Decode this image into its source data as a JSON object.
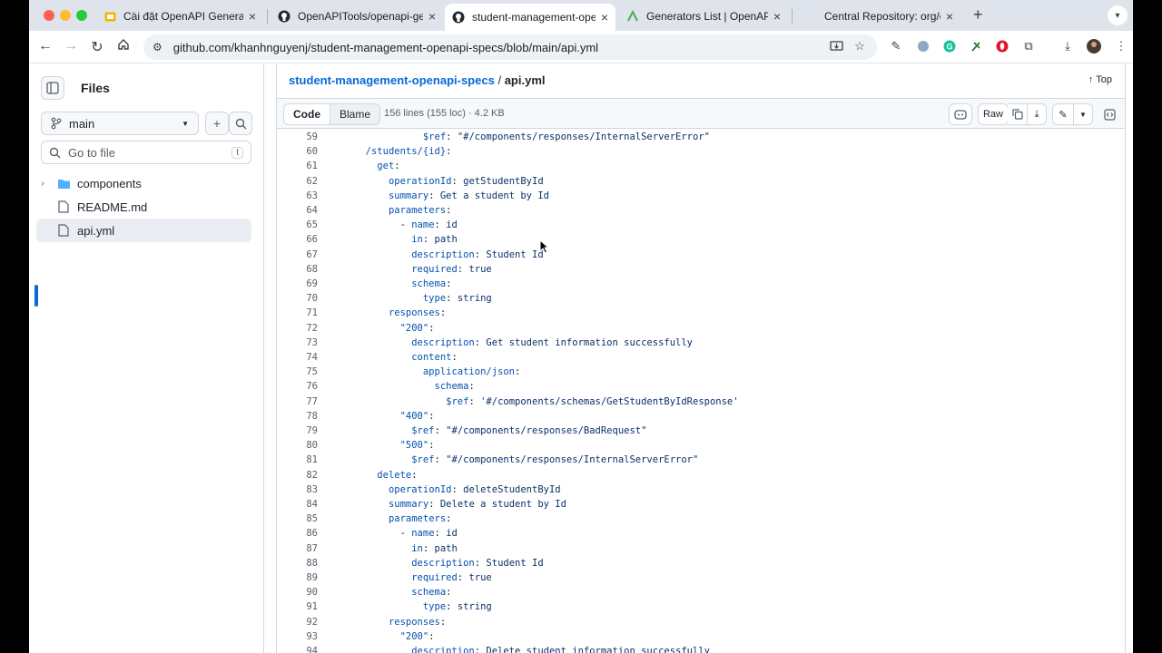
{
  "browser": {
    "tabs": [
      {
        "label": "Cài đặt OpenAPI Generator C",
        "favicon": "slides-icon"
      },
      {
        "label": "OpenAPITools/openapi-gener",
        "favicon": "github-icon"
      },
      {
        "label": "student-management-openap",
        "favicon": "github-icon"
      },
      {
        "label": "Generators List | OpenAPI Ge",
        "favicon": "openapi-icon"
      },
      {
        "label": "Central Repository: org/openc",
        "favicon": "none"
      }
    ],
    "address": "github.com/khanhnguyenj/student-management-openapi-specs/blob/main/api.yml"
  },
  "sidebar": {
    "title": "Files",
    "branch": "main",
    "goto_placeholder": "Go to file",
    "goto_shortcut": "t",
    "tree": [
      {
        "label": "components",
        "type": "folder"
      },
      {
        "label": "README.md",
        "type": "file"
      },
      {
        "label": "api.yml",
        "type": "file",
        "selected": true
      }
    ]
  },
  "breadcrumb": {
    "repo": "student-management-openapi-specs",
    "sep": "/",
    "file": "api.yml"
  },
  "top_link": "Top",
  "file_header": {
    "code_tab": "Code",
    "blame_tab": "Blame",
    "info": "156 lines (155 loc) · 4.2 KB",
    "raw_label": "Raw"
  },
  "code_lines": [
    {
      "n": "59",
      "indent": 6,
      "key": "$ref",
      "val": "\"#/components/responses/InternalServerError\""
    },
    {
      "n": "60",
      "indent": 1,
      "key": "/students/{id}",
      "val": ""
    },
    {
      "n": "61",
      "indent": 2,
      "key": "get",
      "val": ""
    },
    {
      "n": "62",
      "indent": 3,
      "key": "operationId",
      "val": "getStudentById"
    },
    {
      "n": "63",
      "indent": 3,
      "key": "summary",
      "val": "Get a student by Id"
    },
    {
      "n": "64",
      "indent": 3,
      "key": "parameters",
      "val": ""
    },
    {
      "n": "65",
      "indent": 4,
      "key": "name",
      "val": "id",
      "dash": true
    },
    {
      "n": "66",
      "indent": 5,
      "key": "in",
      "val": "path"
    },
    {
      "n": "67",
      "indent": 5,
      "key": "description",
      "val": "Student Id"
    },
    {
      "n": "68",
      "indent": 5,
      "key": "required",
      "val": "true"
    },
    {
      "n": "69",
      "indent": 5,
      "key": "schema",
      "val": ""
    },
    {
      "n": "70",
      "indent": 6,
      "key": "type",
      "val": "string"
    },
    {
      "n": "71",
      "indent": 3,
      "key": "responses",
      "val": ""
    },
    {
      "n": "72",
      "indent": 4,
      "key": "\"200\"",
      "val": ""
    },
    {
      "n": "73",
      "indent": 5,
      "key": "description",
      "val": "Get student information successfully"
    },
    {
      "n": "74",
      "indent": 5,
      "key": "content",
      "val": ""
    },
    {
      "n": "75",
      "indent": 6,
      "key": "application/json",
      "val": ""
    },
    {
      "n": "76",
      "indent": 7,
      "key": "schema",
      "val": ""
    },
    {
      "n": "77",
      "indent": 8,
      "key": "$ref",
      "val": "'#/components/schemas/GetStudentByIdResponse'"
    },
    {
      "n": "78",
      "indent": 4,
      "key": "\"400\"",
      "val": ""
    },
    {
      "n": "79",
      "indent": 5,
      "key": "$ref",
      "val": "\"#/components/responses/BadRequest\""
    },
    {
      "n": "80",
      "indent": 4,
      "key": "\"500\"",
      "val": ""
    },
    {
      "n": "81",
      "indent": 5,
      "key": "$ref",
      "val": "\"#/components/responses/InternalServerError\""
    },
    {
      "n": "82",
      "indent": 2,
      "key": "delete",
      "val": ""
    },
    {
      "n": "83",
      "indent": 3,
      "key": "operationId",
      "val": "deleteStudentById"
    },
    {
      "n": "84",
      "indent": 3,
      "key": "summary",
      "val": "Delete a student by Id"
    },
    {
      "n": "85",
      "indent": 3,
      "key": "parameters",
      "val": ""
    },
    {
      "n": "86",
      "indent": 4,
      "key": "name",
      "val": "id",
      "dash": true
    },
    {
      "n": "87",
      "indent": 5,
      "key": "in",
      "val": "path"
    },
    {
      "n": "88",
      "indent": 5,
      "key": "description",
      "val": "Student Id"
    },
    {
      "n": "89",
      "indent": 5,
      "key": "required",
      "val": "true"
    },
    {
      "n": "90",
      "indent": 5,
      "key": "schema",
      "val": ""
    },
    {
      "n": "91",
      "indent": 6,
      "key": "type",
      "val": "string"
    },
    {
      "n": "92",
      "indent": 3,
      "key": "responses",
      "val": ""
    },
    {
      "n": "93",
      "indent": 4,
      "key": "\"200\"",
      "val": ""
    },
    {
      "n": "94",
      "indent": 5,
      "key": "description",
      "val": "Delete student information successfully"
    }
  ],
  "colors": {
    "link": "#0969da",
    "yaml_key": "#0550ae",
    "yaml_value": "#0a3069"
  }
}
